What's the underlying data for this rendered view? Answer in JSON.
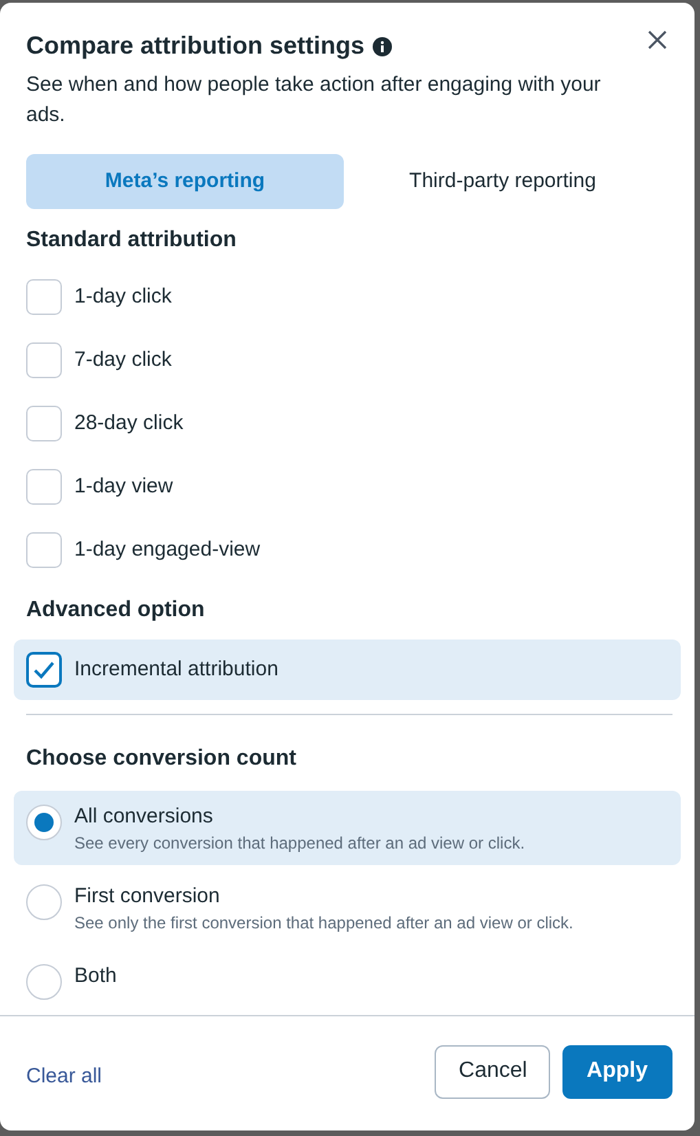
{
  "dialog": {
    "title": "Compare attribution settings",
    "description": "See when and how people take action after engaging with your ads."
  },
  "tabs": [
    {
      "label": "Meta’s reporting",
      "selected": true
    },
    {
      "label": "Third-party reporting",
      "selected": false
    }
  ],
  "standard_attribution": {
    "heading": "Standard attribution",
    "options": [
      {
        "label": "1-day click",
        "checked": false
      },
      {
        "label": "7-day click",
        "checked": false
      },
      {
        "label": "28-day click",
        "checked": false
      },
      {
        "label": "1-day view",
        "checked": false
      },
      {
        "label": "1-day engaged-view",
        "checked": false
      }
    ]
  },
  "advanced_option": {
    "heading": "Advanced option",
    "options": [
      {
        "label": "Incremental attribution",
        "checked": true
      }
    ]
  },
  "conversion_count": {
    "heading": "Choose conversion count",
    "options": [
      {
        "label": "All conversions",
        "description": "See every conversion that happened after an ad view or click.",
        "selected": true
      },
      {
        "label": "First conversion",
        "description": "See only the first conversion that happened after an ad view or click.",
        "selected": false
      },
      {
        "label": "Both",
        "selected": false
      }
    ]
  },
  "footer": {
    "clear_link": "Clear all",
    "buttons": [
      {
        "label": "Cancel",
        "kind": "secondary"
      },
      {
        "label": "Apply",
        "kind": "primary"
      }
    ]
  }
}
